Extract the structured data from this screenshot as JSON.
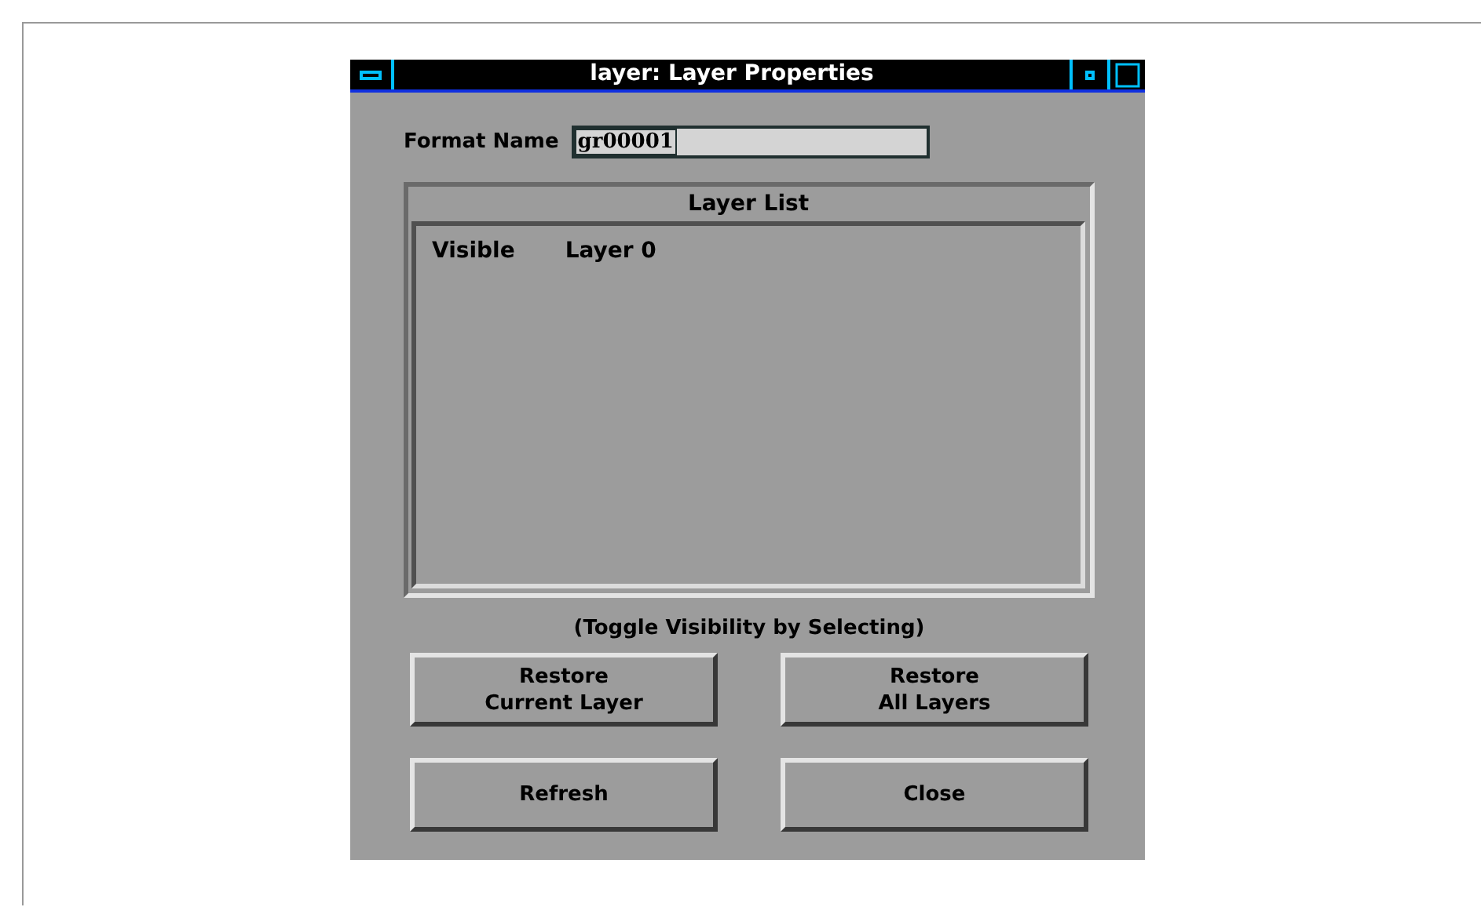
{
  "window": {
    "title": "layer: Layer Properties"
  },
  "format_name": {
    "label": "Format Name",
    "value": "gr00001"
  },
  "layer_list": {
    "title": "Layer List",
    "rows": [
      {
        "visibility": "Visible",
        "name": "Layer 0"
      }
    ]
  },
  "hint": "(Toggle Visibility by Selecting)",
  "buttons": [
    {
      "label": "Restore\nCurrent Layer"
    },
    {
      "label": "Restore\nAll Layers"
    },
    {
      "label": "Refresh"
    },
    {
      "label": "Close"
    }
  ]
}
